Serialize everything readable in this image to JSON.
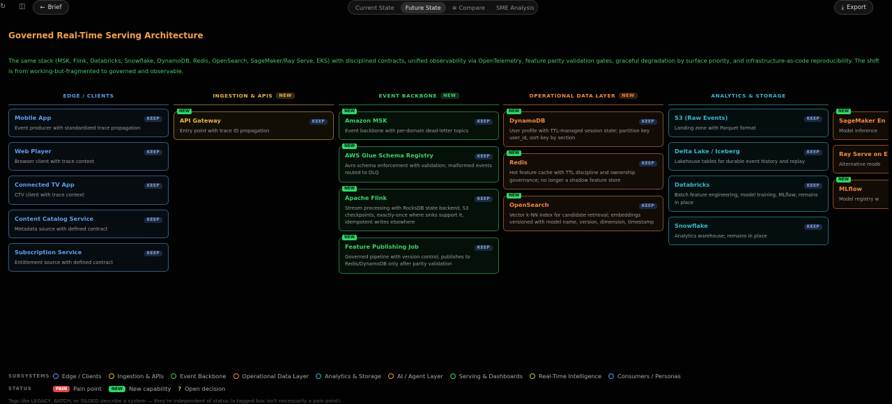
{
  "topbar": {
    "brief_label": "Brief",
    "tabs": [
      "Current State",
      "Future State",
      "Compare",
      "SME Analysis"
    ],
    "active_tab": "Future State",
    "export_label": "Export"
  },
  "page": {
    "title": "Governed Real-Time Serving Architecture",
    "intro": "The same stack (MSK, Flink, Databricks, Snowflake, DynamoDB, Redis, OpenSearch, SageMaker/Ray Serve, EKS) with disciplined contracts, unified observability via OpenTelemetry, feature parity validation gates, graceful degradation by surface priority, and infrastructure-as-code reproducibility. The shift is from working-but-fragmented to governed and observable."
  },
  "columns": [
    {
      "title": "EDGE / CLIENTS",
      "new": false,
      "color": "#5b9ee8",
      "cards": [
        {
          "name": "Mobile App",
          "desc": "Event producer with standardized trace propagation",
          "keep": "KEEP",
          "new": false
        },
        {
          "name": "Web Player",
          "desc": "Browser client with trace context",
          "keep": "KEEP",
          "new": false
        },
        {
          "name": "Connected TV App",
          "desc": "CTV client with trace context",
          "keep": "KEEP",
          "new": false
        },
        {
          "name": "Content Catalog Service",
          "desc": "Metadata source with defined contract",
          "keep": "KEEP",
          "new": false
        },
        {
          "name": "Subscription Service",
          "desc": "Entitlement source with defined contract",
          "keep": "KEEP",
          "new": false
        }
      ]
    },
    {
      "title": "INGESTION & APIS",
      "new": true,
      "color": "#e6b64a",
      "cards": [
        {
          "name": "API Gateway",
          "desc": "Entry point with trace ID propagation",
          "keep": "KEEP",
          "new": true
        }
      ]
    },
    {
      "title": "EVENT BACKBONE",
      "new": true,
      "color": "#3fcf6a",
      "cards": [
        {
          "name": "Amazon MSK",
          "desc": "Event backbone with per-domain dead-letter topics",
          "keep": "KEEP",
          "new": true
        },
        {
          "name": "AWS Glue Schema Registry",
          "desc": "Avro schema enforcement with validation; malformed events routed to DLQ",
          "keep": "KEEP",
          "new": true
        },
        {
          "name": "Apache Flink",
          "desc": "Stream processing with RocksDB state backend, S3 checkpoints, exactly-once where sinks support it, idempotent writes elsewhere",
          "keep": "KEEP",
          "new": true
        },
        {
          "name": "Feature Publishing Job",
          "desc": "Governed pipeline with version control; publishes to Redis/DynamoDB only after parity validation",
          "keep": "KEEP",
          "new": true
        }
      ]
    },
    {
      "title": "OPERATIONAL DATA LAYER",
      "new": true,
      "color": "#f08a44",
      "cards": [
        {
          "name": "DynamoDB",
          "desc": "User profile with TTL-managed session state; partition key user_id, sort key by section",
          "keep": "KEEP",
          "new": true
        },
        {
          "name": "Redis",
          "desc": "Hot feature cache with TTL discipline and ownership governance; no longer a shadow feature store",
          "keep": "KEEP",
          "new": true
        },
        {
          "name": "OpenSearch",
          "desc": "Vector k-NN index for candidate retrieval; embeddings versioned with model name, version, dimension, timestamp",
          "keep": "KEEP",
          "new": true
        }
      ]
    },
    {
      "title": "ANALYTICS & STORAGE",
      "new": false,
      "color": "#3ab7c8",
      "cards": [
        {
          "name": "S3 (Raw Events)",
          "desc": "Landing zone with Parquet format",
          "keep": "KEEP",
          "new": false
        },
        {
          "name": "Delta Lake / Iceberg",
          "desc": "Lakehouse tables for durable event history and replay",
          "keep": "KEEP",
          "new": false
        },
        {
          "name": "Databricks",
          "desc": "Batch feature engineering, model training, MLflow; remains in place",
          "keep": "KEEP",
          "new": false
        },
        {
          "name": "Snowflake",
          "desc": "Analytics warehouse; remains in place",
          "keep": "KEEP",
          "new": false
        }
      ]
    },
    {
      "title": "",
      "new": false,
      "color": "#f08a44",
      "cards": [
        {
          "name": "SageMaker En",
          "desc": "Model inference",
          "keep": "",
          "new": true
        },
        {
          "name": "Ray Serve on E",
          "desc": "Alternative mode",
          "keep": "",
          "new": false
        },
        {
          "name": "MLflow",
          "desc": "Model registry w",
          "keep": "",
          "new": true
        }
      ]
    }
  ],
  "legend": {
    "subsystems_label": "SUBSYSTEMS",
    "subsystems": [
      {
        "name": "Edge / Clients",
        "color": "#5b9ee8"
      },
      {
        "name": "Ingestion & APIs",
        "color": "#e6b64a"
      },
      {
        "name": "Event Backbone",
        "color": "#3fcf6a"
      },
      {
        "name": "Operational Data Layer",
        "color": "#f08a44"
      },
      {
        "name": "Analytics & Storage",
        "color": "#3ab7c8"
      },
      {
        "name": "AI / Agent Layer",
        "color": "#f0a040"
      },
      {
        "name": "Serving & Dashboards",
        "color": "#3fcf6a"
      },
      {
        "name": "Real-Time Intelligence",
        "color": "#c9c94a"
      },
      {
        "name": "Consumers / Personas",
        "color": "#6b8ee8"
      }
    ],
    "status_label": "STATUS",
    "pain_badge": "PAIN",
    "pain_label": "Pain point",
    "new_badge": "NEW",
    "new_label": "New capability",
    "open_mark": "?",
    "open_label": "Open decision",
    "footnote": "Tags like LEGACY, BATCH, or SILOED describe a system — they're independent of status (a tagged box isn't necessarily a pain point)."
  }
}
